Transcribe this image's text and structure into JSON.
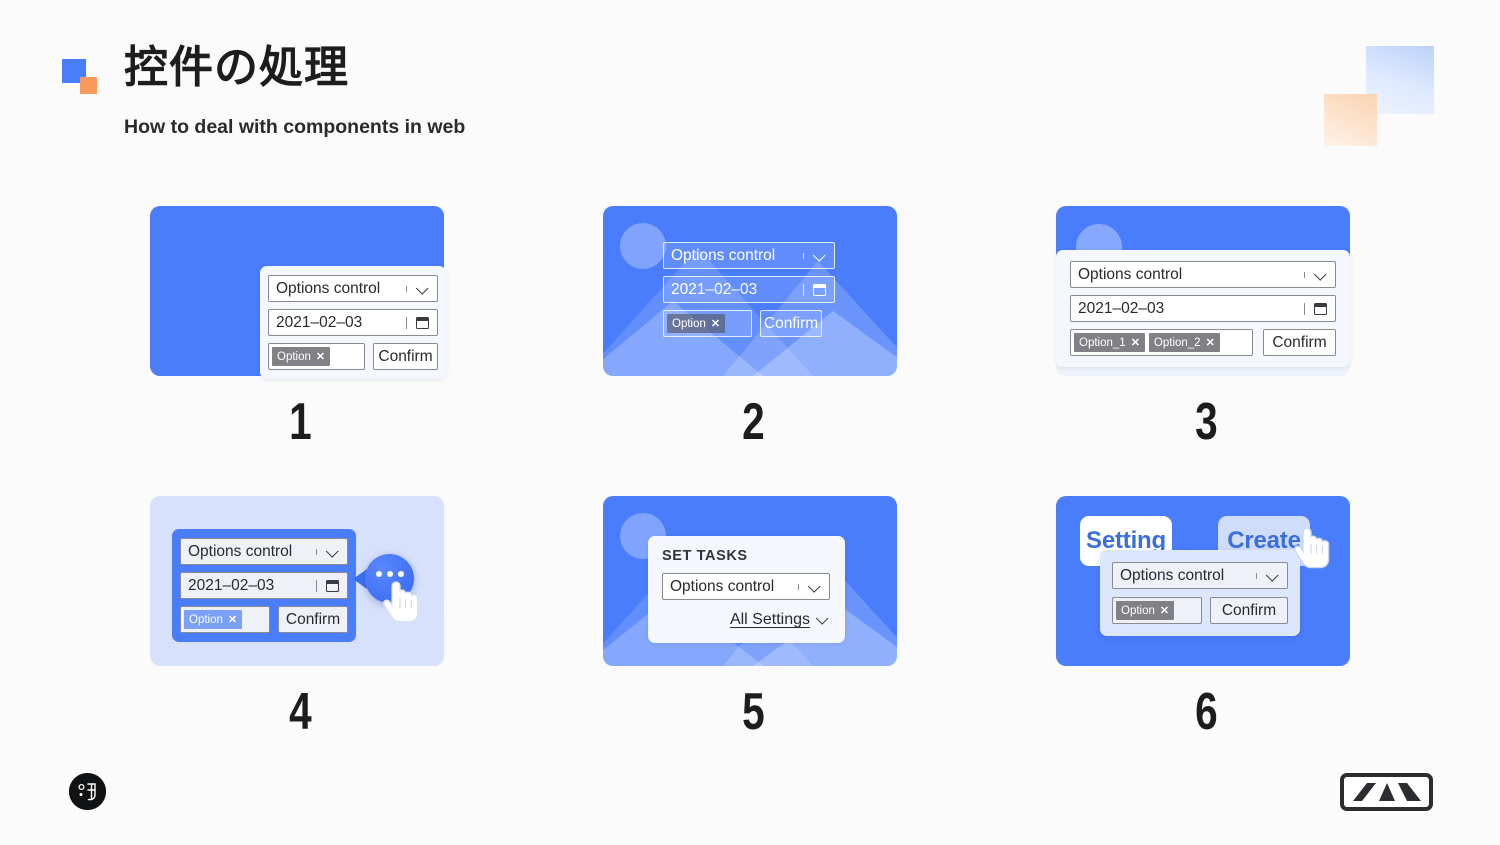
{
  "page": {
    "background": "#fbfbfb",
    "accent_blue": "#4a7dfc",
    "accent_orange": "#f79a5b",
    "chip_gray": "#808085"
  },
  "header": {
    "title": "控件の処理",
    "subtitle": "How to deal with components in web",
    "logo_icon": "two-squares-icon",
    "deco_icon": "overlapping-squares-decoration"
  },
  "controls": {
    "select_value": "Options control",
    "select_chevron_icon": "chevron-down-icon",
    "date_value": "2021–02–03",
    "date_calendar_icon": "calendar-icon",
    "chip_label": "Option",
    "chip_label_1": "Option_1",
    "chip_label_2": "Option_2",
    "chip_remove_icon": "close-x-icon",
    "confirm_label": "Confirm"
  },
  "examples": [
    {
      "number": "1",
      "style": "solid-blue-card-white-panel",
      "has_select": true,
      "has_date": true,
      "has_chips": true,
      "chips": [
        "Option"
      ],
      "has_confirm": true
    },
    {
      "number": "2",
      "style": "blue-illustration-transparent-controls",
      "art": [
        "sun-circle-icon",
        "mountain-shape-icon"
      ],
      "has_select": true,
      "has_date": true,
      "has_chips": true,
      "chips": [
        "Option"
      ],
      "has_confirm": true
    },
    {
      "number": "3",
      "style": "blue-header-light-panel",
      "art": [
        "sun-circle-icon"
      ],
      "has_select": true,
      "has_date": true,
      "has_chips": true,
      "chips": [
        "Option_1",
        "Option_2"
      ],
      "has_confirm": true
    },
    {
      "number": "4",
      "style": "lavender-card-blue-panel-with-bubble",
      "has_select": true,
      "has_date": true,
      "has_chips": true,
      "chips": [
        "Option"
      ],
      "has_confirm": true,
      "bubble_icon": "ellipsis-bubble-icon",
      "cursor_icon": "hand-pointer-icon"
    },
    {
      "number": "5",
      "style": "blue-illustration-white-dialog",
      "art": [
        "sun-circle-icon",
        "mountain-shape-icon"
      ],
      "dialog_title": "SET TASKS",
      "has_select": true,
      "link_label": "All Settings",
      "link_chevron_icon": "chevron-down-icon"
    },
    {
      "number": "6",
      "style": "blue-card-tabs-overlay-panel",
      "tabs": [
        {
          "label": "Setting",
          "active": true
        },
        {
          "label": "Create",
          "active": false
        }
      ],
      "has_select": true,
      "has_chips": true,
      "chips": [
        "Option"
      ],
      "has_confirm": true,
      "cursor_icon": "hand-pointer-icon"
    }
  ],
  "footer": {
    "left_logo_icon": "circular-brand-logo",
    "right_logo_icon": "m-mark-brand-logo"
  }
}
